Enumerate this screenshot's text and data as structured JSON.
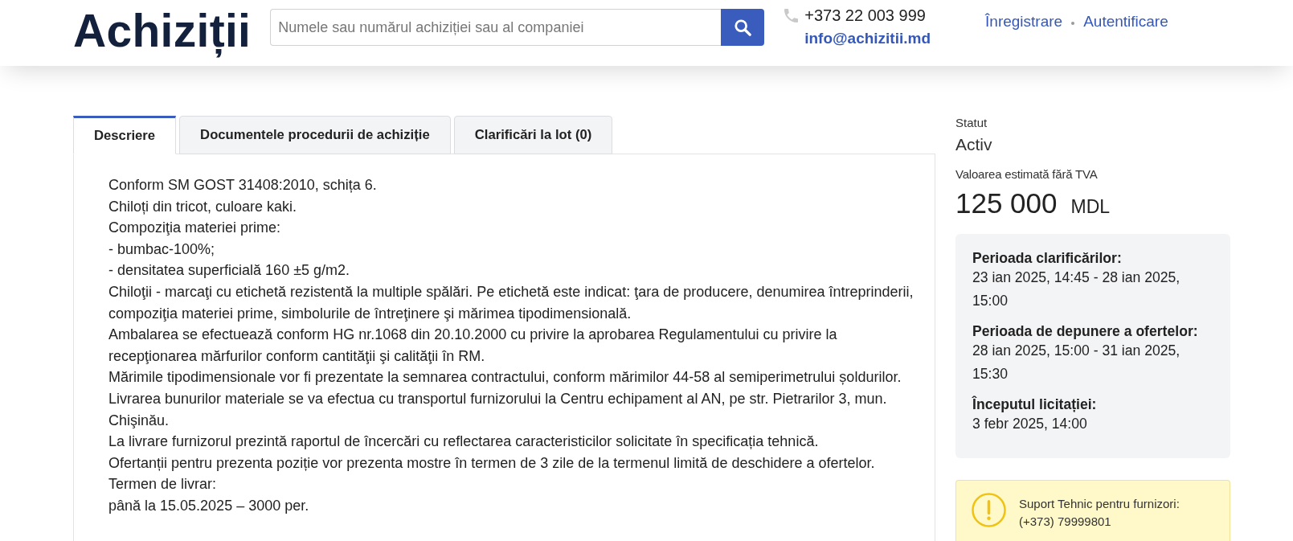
{
  "header": {
    "logo": "Achiziții",
    "search": {
      "placeholder": "Numele sau numărul achiziției sau al companiei"
    },
    "phone": "+373 22 003 999",
    "email": "info@achizitii.md",
    "links": [
      "Înregistrare",
      "Autentificare"
    ]
  },
  "tabs": [
    {
      "label": "Descriere",
      "selected": true
    },
    {
      "label": "Documentele procedurii de achiziție",
      "selected": false
    },
    {
      "label": "Clarificări la lot (0)",
      "selected": false
    }
  ],
  "description": {
    "lines": [
      "Conform SM GOST 31408:2010, schița 6.",
      "Chiloți din tricot, culoare kaki.",
      "Compoziţia materiei prime:",
      "- bumbac-100%;",
      "- densitatea superficială 160 ±5 g/m2.",
      "Chiloţii - marcaţi cu etichetă rezistentă la multiple spălări. Pe etichetă este indicat: ţara de producere, denumirea întreprinderii, compoziţia materiei prime, simbolurile de întreţinere şi mărimea tipodimensională.",
      "Ambalarea se efectuează conform HG nr.1068 din 20.10.2000 cu privire la aprobarea Regulamentului cu privire la recepţionarea mărfurilor conform cantităţii şi calităţii în RM.",
      "Mărimile tipodimensionale vor fi prezentate la semnarea contractului, conform mărimilor 44-58 al semiperimetrului șoldurilor.",
      "Livrarea bunurilor materiale se va efectua cu transportul furnizorului la Centru echipament al AN, pe str. Pietrarilor 3, mun. Chişinău.",
      "La livrare furnizorul prezintă raportul de încercări cu reflectarea caracteristicilor solicitate în specificația tehnică.",
      "Ofertanții pentru prezenta poziție vor prezenta mostre în termen de 3 zile de la termenul limită de deschidere a ofertelor.",
      "Termen de livrar:",
      "până la 15.05.2025 – 3000 per."
    ]
  },
  "sidebar": {
    "status": {
      "label": "Statut",
      "value": "Activ"
    },
    "estimate": {
      "label": "Valoarea estimată fără TVA",
      "amount": "125 000",
      "currency": "MDL"
    },
    "periods": [
      {
        "label": "Perioada clarificărilor:",
        "value": "23 ian 2025, 14:45 - 28 ian 2025, 15:00"
      },
      {
        "label": "Perioada de depunere a ofertelor:",
        "value": "28 ian 2025, 15:00 - 31 ian 2025, 15:30"
      },
      {
        "label": "Începutul licitației:",
        "value": "3 febr 2025, 14:00"
      }
    ],
    "support": {
      "title": "Suport Tehnic pentru furnizori:",
      "phone": "(+373) 79999801"
    }
  }
}
